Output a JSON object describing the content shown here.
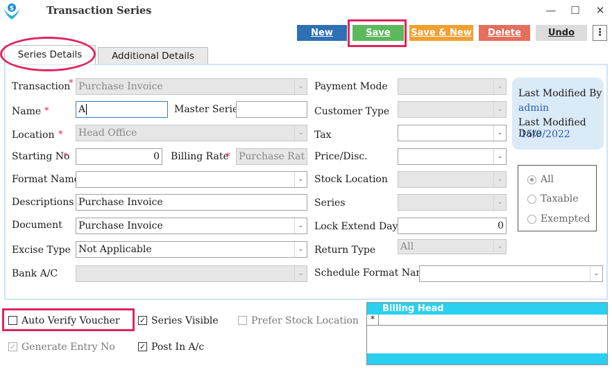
{
  "window": {
    "title": "Transaction Series",
    "minimize": "—",
    "maximize": "☐",
    "close": "✕"
  },
  "toolbar": {
    "new": "New",
    "save": "Save",
    "save_new": "Save & New",
    "delete": "Delete",
    "undo": "Undo",
    "more": "⋮"
  },
  "tabs": {
    "series_details": "Series Details",
    "additional_details": "Additional Details"
  },
  "form": {
    "transaction": {
      "label": "Transaction",
      "value": "Purchase Invoice"
    },
    "name": {
      "label": "Name",
      "value": "A"
    },
    "master_series": {
      "label": "Master Series",
      "value": ""
    },
    "location": {
      "label": "Location",
      "value": "Head Office"
    },
    "starting_no": {
      "label": "Starting No",
      "value": "0"
    },
    "billing_rate": {
      "label": "Billing Rate",
      "value": "Purchase Rat"
    },
    "format_name": {
      "label": "Format Name",
      "value": ""
    },
    "descriptions": {
      "label": "Descriptions",
      "value": "Purchase Invoice"
    },
    "document": {
      "label": "Document",
      "value": "Purchase Invoice"
    },
    "excise_type": {
      "label": "Excise Type",
      "value": "Not Applicable"
    },
    "bank_ac": {
      "label": "Bank A/C",
      "value": ""
    },
    "payment_mode": {
      "label": "Payment Mode",
      "value": ""
    },
    "customer_type": {
      "label": "Customer Type",
      "value": ""
    },
    "tax": {
      "label": "Tax",
      "value": ""
    },
    "price_disc": {
      "label": "Price/Disc.",
      "value": ""
    },
    "stock_location": {
      "label": "Stock Location",
      "value": ""
    },
    "series": {
      "label": "Series",
      "value": ""
    },
    "lock_extend_days": {
      "label": "Lock Extend Days",
      "value": "0"
    },
    "return_type": {
      "label": "Return Type",
      "value": "All"
    },
    "schedule_format_name": {
      "label": "Schedule Format Name",
      "value": ""
    }
  },
  "last_modified": {
    "by_label": "Last Modified By",
    "by_value": "admin",
    "date_label": "Last Modified Date",
    "date_value": "15/9/2022"
  },
  "tax_options": {
    "all": "All",
    "taxable": "Taxable",
    "exempted": "Exempted",
    "selected": "All"
  },
  "checkboxes": {
    "auto_verify_voucher": {
      "label": "Auto Verify Voucher",
      "checked": false
    },
    "series_visible": {
      "label": "Series Visible",
      "checked": true
    },
    "prefer_stock_location": {
      "label": "Prefer Stock Location",
      "checked": false
    },
    "generate_entry_no": {
      "label": "Generate Entry No",
      "checked": true
    },
    "post_in_ac": {
      "label": "Post In A/c",
      "checked": true
    }
  },
  "billing_head": {
    "title": "Billing Head",
    "new_row_marker": "*"
  },
  "colors": {
    "highlight": "#e0245e",
    "new_button": "#2f6fb3",
    "save_button": "#5cb85c",
    "save_new_button": "#f0a030",
    "delete_button": "#e36f5c",
    "grid_header": "#2ad0f0"
  }
}
